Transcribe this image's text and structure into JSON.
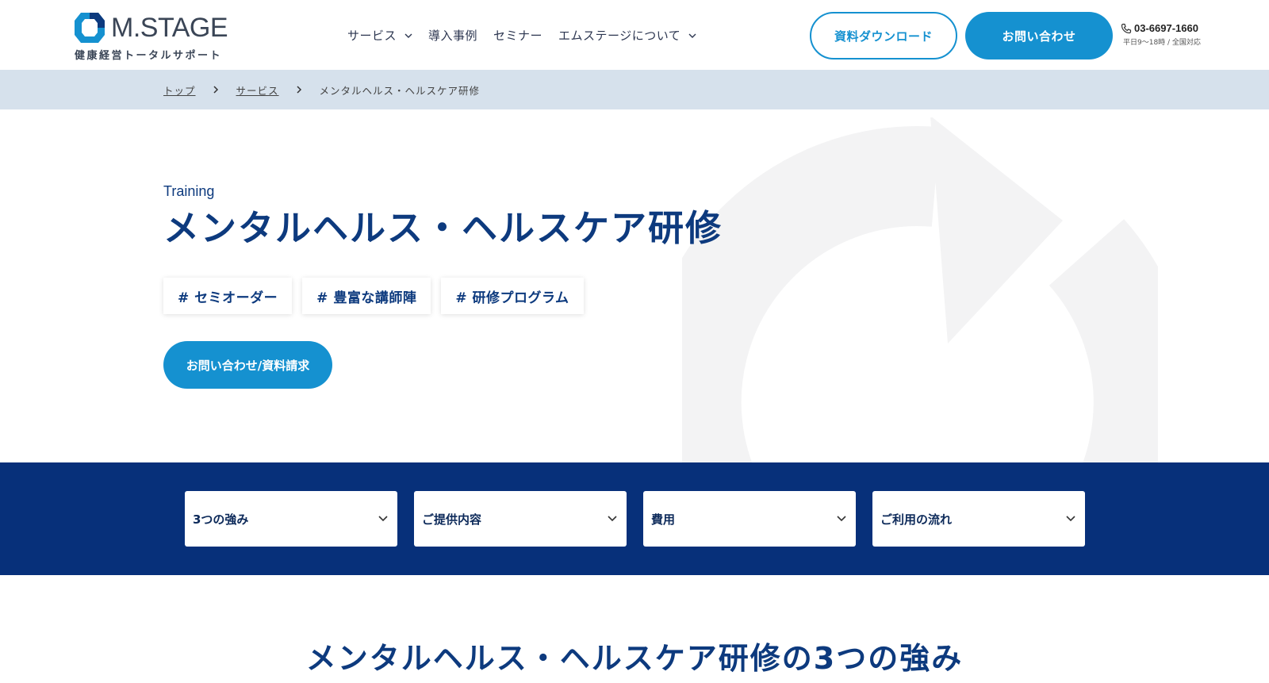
{
  "header": {
    "logo_text": "M.STAGE",
    "logo_subtitle": "健康経営トータルサポート",
    "nav": [
      {
        "label": "サービス",
        "has_dropdown": true
      },
      {
        "label": "導入事例",
        "has_dropdown": false
      },
      {
        "label": "セミナー",
        "has_dropdown": false
      },
      {
        "label": "エムステージについて",
        "has_dropdown": true
      }
    ],
    "download_label": "資料ダウンロード",
    "contact_label": "お問い合わせ",
    "phone": "03-6697-1660",
    "phone_hours": "平日9〜18時 / 全国対応"
  },
  "breadcrumb": {
    "items": [
      "トップ",
      "サービス"
    ],
    "current": "メンタルヘルス・ヘルスケア研修"
  },
  "hero": {
    "eyebrow": "Training",
    "title": "メンタルヘルス・ヘルスケア研修",
    "tags": [
      "# セミオーダー",
      "# 豊富な講師陣",
      "# 研修プログラム"
    ],
    "cta_label": "お問い合わせ/資料請求"
  },
  "anchors": [
    "3つの強み",
    "ご提供内容",
    "費用",
    "ご利用の流れ"
  ],
  "section": {
    "title": "メンタルヘルス・ヘルスケア研修の3つの強み"
  },
  "colors": {
    "primary_navy": "#0d3a7e",
    "accent_blue": "#1591d0",
    "band_navy": "#07307a",
    "breadcrumb_bg": "#d6e1ec"
  },
  "icons": [
    "logo-hexagon-icon",
    "chevron-down-icon",
    "phone-icon",
    "chevron-right-icon",
    "circular-arrow-icon"
  ]
}
